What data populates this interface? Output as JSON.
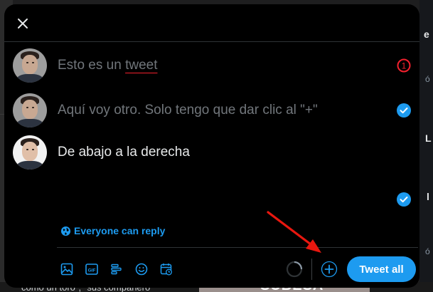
{
  "background": {
    "right_fragments": [
      "e",
      "ª",
      "ó",
      "L",
      "l",
      "ó"
    ],
    "bottom_caption": "como un toro\", \"sus compañero",
    "bottom_image_text": "SUBESA"
  },
  "composer": {
    "close_icon": "close-icon",
    "tweets": [
      {
        "text_prefix": "Esto es un ",
        "text_misspelled": "tweet",
        "status": "over-limit",
        "counter": "1"
      },
      {
        "text": "Aquí voy otro. Solo tengo que dar clic al \"+\"",
        "status": "check"
      },
      {
        "text": "De abajo a la derecha",
        "status": "active"
      }
    ],
    "reply_setting": {
      "icon": "globe-icon",
      "label": "Everyone can reply"
    },
    "toolbar": [
      {
        "icon": "image-icon"
      },
      {
        "icon": "gif-icon",
        "label": "GIF"
      },
      {
        "icon": "poll-icon"
      },
      {
        "icon": "emoji-icon"
      },
      {
        "icon": "schedule-icon"
      }
    ],
    "add_tweet_icon": "plus-icon",
    "tweet_all_label": "Tweet all"
  },
  "colors": {
    "accent": "#1d9bf0",
    "error": "#f4212e",
    "annotation_arrow": "#e8170f",
    "modal_bg": "#000000"
  }
}
